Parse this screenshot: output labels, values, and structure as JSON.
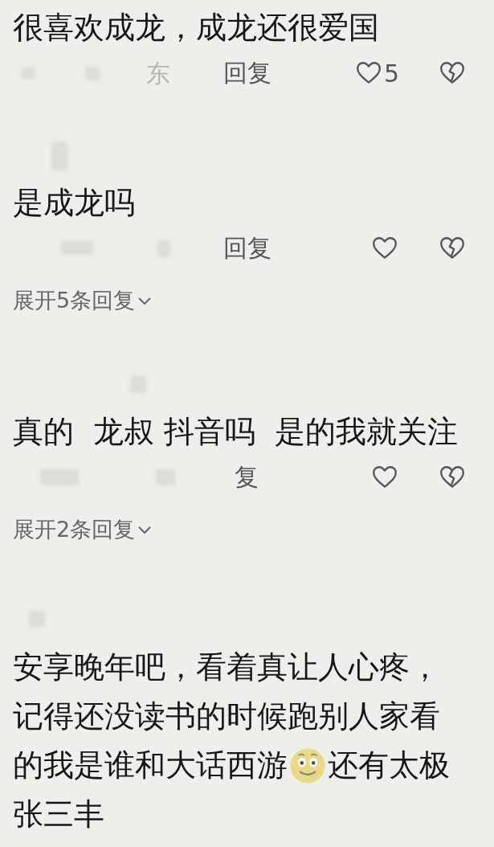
{
  "comments": [
    {
      "lines": [
        [
          {
            "kind": "text",
            "text": "很喜欢成龙，成龙还很爱国"
          }
        ]
      ],
      "location": "东",
      "reply": "回复",
      "likes": "5"
    },
    {
      "lines": [
        [
          {
            "kind": "text",
            "text": "是成龙吗"
          }
        ]
      ],
      "reply": "回复",
      "expand": "展开5条回复"
    },
    {
      "lines": [
        [
          {
            "kind": "text",
            "text": "真的  龙叔 抖音吗  是的我就关注"
          }
        ]
      ],
      "reply": "复",
      "expand": "展开2条回复"
    },
    {
      "lines": [
        [
          {
            "kind": "text",
            "text": "安享晚年吧，看着真让人心疼，"
          }
        ],
        [
          {
            "kind": "text",
            "text": "记得还没读书的时候跑别人家看"
          }
        ],
        [
          {
            "kind": "text",
            "text": "的我是谁和大话西游"
          },
          {
            "kind": "emoji"
          },
          {
            "kind": "text",
            "text": "还有太极"
          }
        ],
        [
          {
            "kind": "text",
            "text": "张三丰"
          }
        ]
      ]
    }
  ]
}
